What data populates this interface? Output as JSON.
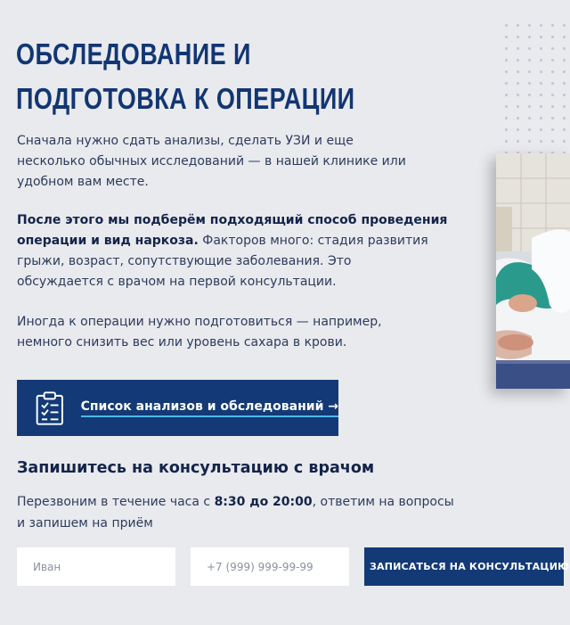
{
  "heading": {
    "line1": "ОБСЛЕДОВАНИЕ И",
    "line2": "ПОДГОТОВКА К ОПЕРАЦИИ"
  },
  "paragraphs": {
    "p1": [
      "Сначала нужно сдать анализы, сделать УЗИ и еще",
      "несколько обычных исследований — в нашей клинике или",
      "удобном вам месте."
    ],
    "p2": {
      "bold1": "После этого мы подберём подходящий способ проведения",
      "bold2": "операции и вид наркоза.",
      "rest2": " Факторов много: стадия развития",
      "line3": "грыжи, возраст, сопутствующие заболевания. Это",
      "line4": "обсуждается с врачом на первой консультации."
    },
    "p3": [
      "Иногда к операции нужно подготовиться — например,",
      "немного снизить вес или уровень сахара в крови."
    ]
  },
  "tests_button": {
    "label": "Список анализов и обследований →",
    "icon": "clipboard-checklist-icon"
  },
  "consult": {
    "title": "Запишитесь на консультацию с врачом",
    "text_before": "Перезвоним в течение часа с ",
    "text_bold": "8:30 до 20:00",
    "text_after": ", ответим на вопросы",
    "text_line2": "и запишем на приём"
  },
  "form": {
    "name_placeholder": "Иван",
    "phone_placeholder": "+7 (999) 999-99-99",
    "submit_label": "ЗАПИСАТЬСЯ НА КОНСУЛЬТАЦИЮ"
  },
  "colors": {
    "background": "#e9eaee",
    "brand_navy": "#133a76",
    "heading": "#123673",
    "underline_accent": "#4fb7ea"
  }
}
